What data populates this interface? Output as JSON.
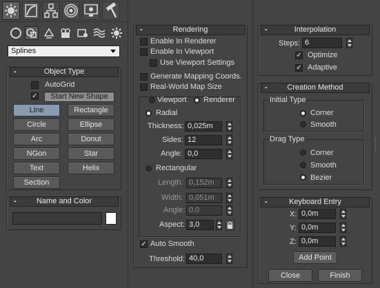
{
  "colors": {
    "panel_bg": "#444444",
    "button_active": "#8a9bb0",
    "field_bg": "#2f2f2f",
    "white": "#ffffff"
  },
  "command_tabs": [
    {
      "name": "create",
      "icon": "sun-gear-icon"
    },
    {
      "name": "modify",
      "icon": "bent-wire-icon"
    },
    {
      "name": "hierarchy",
      "icon": "hierarchy-icon"
    },
    {
      "name": "motion",
      "icon": "motion-circle-icon"
    },
    {
      "name": "display",
      "icon": "monitor-icon"
    },
    {
      "name": "utilities",
      "icon": "hammer-icon"
    }
  ],
  "create_categories": [
    "geometry-icon",
    "shapes-icon",
    "lights-icon",
    "cameras-icon",
    "helpers-icon",
    "space-warps-icon",
    "systems-icon"
  ],
  "category_dropdown": {
    "value": "Splines"
  },
  "object_type": {
    "title": "Object Type",
    "autogrid_label": "AutoGrid",
    "start_new_shape_label": "Start New Shape",
    "buttons": [
      "Line",
      "Rectangle",
      "Circle",
      "Ellipse",
      "Arc",
      "Donut",
      "NGon",
      "Star",
      "Text",
      "Helix",
      "Section"
    ]
  },
  "name_and_color": {
    "title": "Name and Color",
    "name_value": ""
  },
  "rendering": {
    "title": "Rendering",
    "enable_in_renderer": "Enable In Renderer",
    "enable_in_viewport": "Enable In Viewport",
    "use_viewport_settings": "Use Viewport Settings",
    "generate_mapping": "Generate Mapping Coords.",
    "real_world_map_size": "Real-World Map Size",
    "viewport_label": "Viewport",
    "renderer_label": "Renderer",
    "radial_label": "Radial",
    "thickness_label": "Thickness:",
    "thickness_value": "0,025m",
    "sides_label": "Sides:",
    "sides_value": "12",
    "angle_label": "Angle:",
    "angle_value": "0,0",
    "rectangular_label": "Rectangular",
    "length_label": "Length:",
    "length_value": "0,152m",
    "width_label": "Width:",
    "width_value": "0,051m",
    "angle2_label": "Angle:",
    "angle2_value": "0,0",
    "aspect_label": "Aspect:",
    "aspect_value": "3,0",
    "auto_smooth_label": "Auto Smooth",
    "threshold_label": "Threshold:",
    "threshold_value": "40,0"
  },
  "interpolation": {
    "title": "Interpolation",
    "steps_label": "Steps:",
    "steps_value": "6",
    "optimize_label": "Optimize",
    "adaptive_label": "Adaptive"
  },
  "creation_method": {
    "title": "Creation Method",
    "initial_type_label": "Initial Type",
    "corner_label": "Corner",
    "smooth_label": "Smooth",
    "drag_type_label": "Drag Type",
    "drag_corner_label": "Corner",
    "drag_smooth_label": "Smooth",
    "bezier_label": "Bezier"
  },
  "keyboard_entry": {
    "title": "Keyboard Entry",
    "x_label": "X:",
    "x_value": "0,0m",
    "y_label": "Y:",
    "y_value": "0,0m",
    "z_label": "Z:",
    "z_value": "0,0m",
    "add_point_label": "Add Point",
    "close_label": "Close",
    "finish_label": "Finish"
  }
}
